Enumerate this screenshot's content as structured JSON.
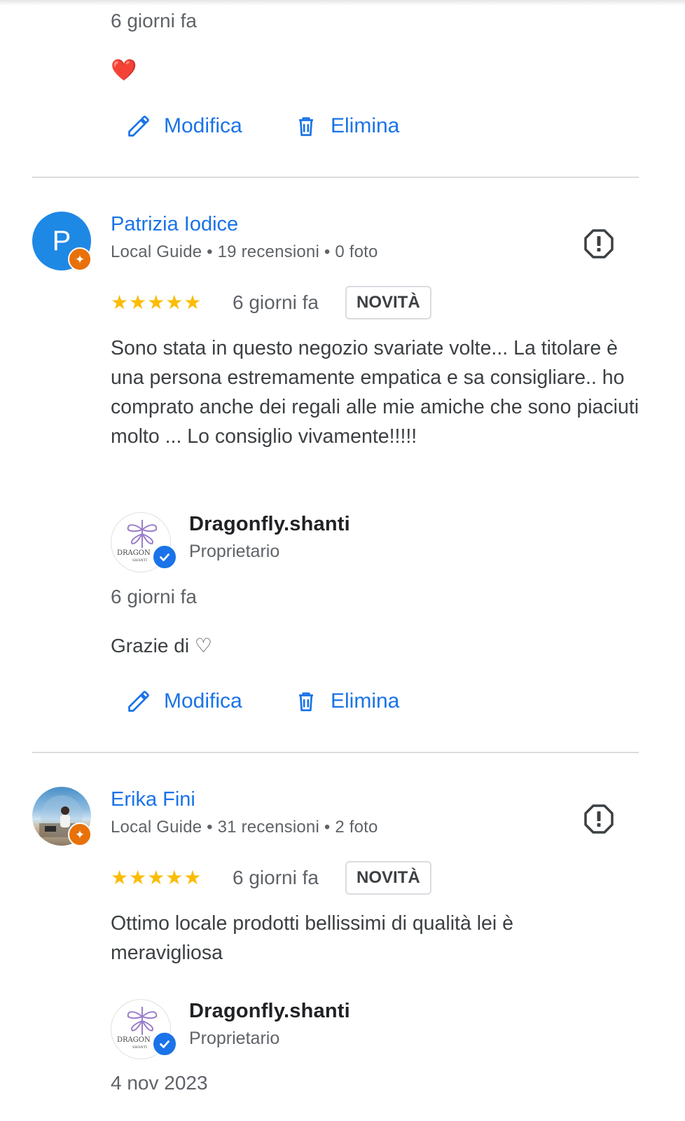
{
  "review0": {
    "reply_date": "6 giorni fa",
    "reply_text": "❤️",
    "edit_label": "Modifica",
    "delete_label": "Elimina"
  },
  "review1": {
    "avatar_letter": "P",
    "author": "Patrizia Iodice",
    "meta": "Local Guide • 19 recensioni • 0 foto",
    "rating": 5,
    "stars": "★★★★★",
    "date": "6 giorni fa",
    "badge": "NOVITÀ",
    "text": "Sono stata in questo negozio svariate volte... La titolare è una persona estremamente empatica e sa consigliare.. ho comprato anche dei regali alle mie amiche che sono piaciuti molto ... Lo consiglio vivamente!!!!!",
    "owner_name": "Dragonfly.shanti",
    "owner_role": "Proprietario",
    "owner_logo_text": "DRAGON",
    "owner_logo_subtext": "SHANTI",
    "reply_date": "6 giorni fa",
    "reply_text": "Grazie di ♡",
    "edit_label": "Modifica",
    "delete_label": "Elimina"
  },
  "review2": {
    "author": "Erika Fini",
    "meta": "Local Guide • 31 recensioni • 2 foto",
    "rating": 5,
    "stars": "★★★★★",
    "date": "6 giorni fa",
    "badge": "NOVITÀ",
    "text": "Ottimo locale prodotti bellissimi di qualità lei è meravigliosa",
    "owner_name": "Dragonfly.shanti",
    "owner_role": "Proprietario",
    "owner_logo_text": "DRAGON",
    "owner_logo_subtext": "SHANTI",
    "reply_date": "4 nov 2023"
  },
  "colors": {
    "accent": "#1a73e8",
    "star": "#fbbc04",
    "guide_badge": "#e8710a",
    "avatar_p": "#1e88e5"
  },
  "icons": [
    "pencil-icon",
    "trash-icon",
    "report-icon",
    "local-guide-icon",
    "verified-icon",
    "dragonfly-icon"
  ]
}
